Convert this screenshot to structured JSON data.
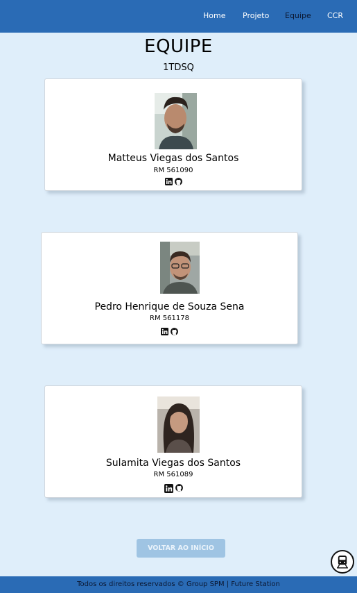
{
  "nav": {
    "links": [
      {
        "label": "Home",
        "active": false
      },
      {
        "label": "Projeto",
        "active": false
      },
      {
        "label": "Equipe",
        "active": true
      },
      {
        "label": "CCR",
        "active": false
      }
    ]
  },
  "page": {
    "title": "EQUIPE",
    "subtitle": "1TDSQ"
  },
  "members": [
    {
      "name": "Matteus Viegas dos Santos",
      "rm": "RM 561090",
      "icons": [
        "linkedin-icon",
        "github-icon"
      ]
    },
    {
      "name": "Pedro Henrique de Souza Sena",
      "rm": "RM 561178",
      "icons": [
        "linkedin-icon",
        "github-icon"
      ]
    },
    {
      "name": "Sulamita Viegas dos Santos",
      "rm": "RM 561089",
      "icons": [
        "linkedin-icon",
        "github-icon"
      ]
    }
  ],
  "actions": {
    "back_label": "VOLTAR AO INÍCIO",
    "train_icon": "train-icon"
  },
  "footer": {
    "text": "Todos os direitos reservados © Group SPM | Future Station"
  },
  "colors": {
    "header": "#2a6bb5",
    "background": "#dfeefa",
    "button": "#9fc4e3",
    "active_nav": "#0b1730"
  }
}
